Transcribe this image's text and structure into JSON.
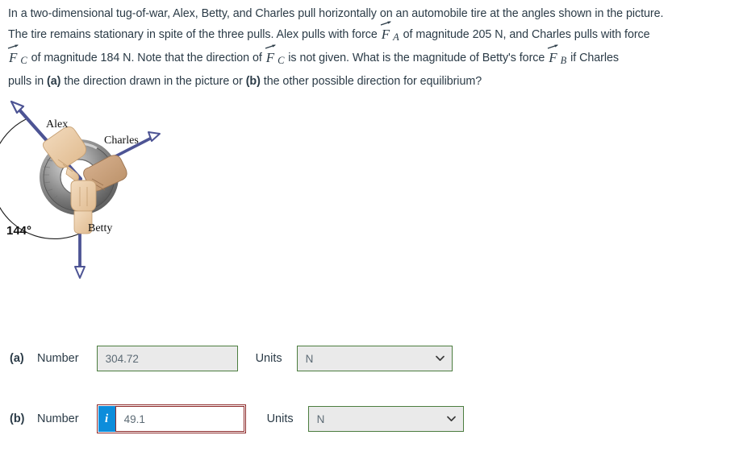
{
  "question": {
    "line1": "In a two-dimensional tug-of-war, Alex, Betty, and Charles pull horizontally on an automobile tire at the angles shown in the picture.",
    "line2_a": "The tire remains stationary in spite of the three pulls. Alex pulls with force",
    "line2_vec_symbol": "F",
    "line2_sub": "A",
    "line2_b": "of magnitude 205 N, and Charles pulls with force",
    "line3_vec_symbol": "F",
    "line3_sub_c1": "C",
    "line3_a": "of magnitude 184 N. Note that the direction of",
    "line3_vec2_symbol": "F",
    "line3_sub_c2": "C",
    "line3_b": "is not given. What is the magnitude of Betty's force",
    "line3_vec3_symbol": "F",
    "line3_sub_b": "B",
    "line3_c": "if Charles",
    "line4_a": "pulls in",
    "line4_bold_a": "(a)",
    "line4_b": "the direction drawn in the picture or",
    "line4_bold_b": "(b)",
    "line4_c": "the other possible direction for equilibrium?"
  },
  "figure": {
    "label_alex": "Alex",
    "label_charles": "Charles",
    "label_betty": "Betty",
    "angle_label": "144°",
    "arrow_color": "#4d5494",
    "tire_outer_color": "#8a8a8a",
    "hand_color": "#e8c09a"
  },
  "answers": {
    "a": {
      "row_label": "(a)",
      "number_label": "Number",
      "value": "304.72",
      "units_label": "Units",
      "unit_value": "N",
      "unit_options": [
        "N"
      ],
      "border_color": "#4c7d3f",
      "status": "correct"
    },
    "b": {
      "row_label": "(b)",
      "number_label": "Number",
      "info_glyph": "i",
      "value": "49.1",
      "units_label": "Units",
      "unit_value": "N",
      "unit_options": [
        "N"
      ],
      "border_color": "#8d2a2a",
      "info_color": "#0d8ddb",
      "status": "incorrect"
    }
  }
}
